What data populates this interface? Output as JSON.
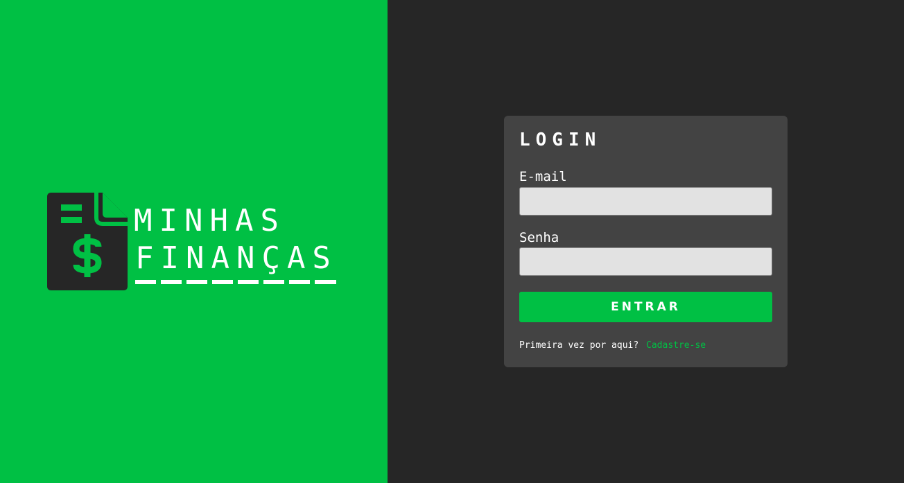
{
  "brand": {
    "line1": "MINHAS",
    "line2": "FINANÇAS",
    "icon": "dollar-document-icon",
    "accent_color": "#00c044",
    "dark_color": "#262626"
  },
  "login": {
    "title": "LOGIN",
    "email_label": "E-mail",
    "email_value": "",
    "password_label": "Senha",
    "password_value": "",
    "submit_label": "ENTRAR",
    "signup_prompt": "Primeira vez por aqui?",
    "signup_link": "Cadastre-se",
    "card_color": "#434343",
    "input_color": "#e2e2e2"
  }
}
